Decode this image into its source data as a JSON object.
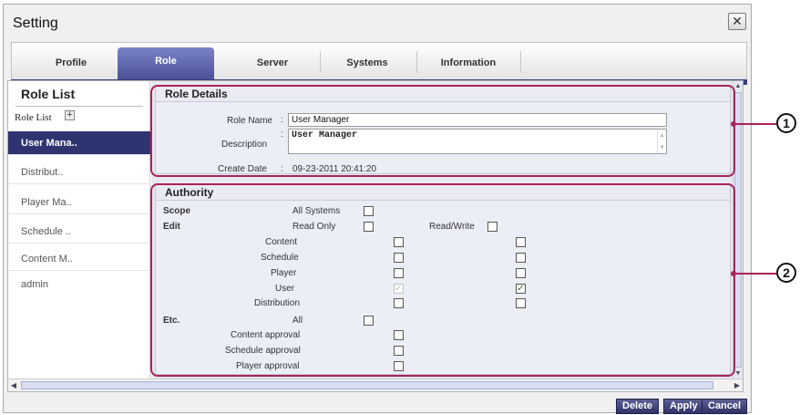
{
  "window": {
    "title": "Setting",
    "close_glyph": "✕"
  },
  "tabs": [
    {
      "label": "Profile"
    },
    {
      "label": "Role",
      "active": true
    },
    {
      "label": "Server"
    },
    {
      "label": "Systems"
    },
    {
      "label": "Information"
    }
  ],
  "sidebar": {
    "title": "Role List",
    "subtitle": "Role List",
    "add_glyph": "+",
    "items": [
      {
        "label": "User Mana..",
        "selected": true
      },
      {
        "label": "Distribut.."
      },
      {
        "label": "Player Ma.."
      },
      {
        "label": "Schedule .."
      },
      {
        "label": "Content M.."
      },
      {
        "label": "admin"
      }
    ]
  },
  "role_details": {
    "heading": "Role Details",
    "name_label": "Role Name",
    "name_value": "User Manager",
    "desc_label": "Description",
    "desc_value": "User Manager",
    "date_label": "Create Date",
    "date_value": "09-23-2011 20:41:20",
    "colon": ":"
  },
  "authority": {
    "heading": "Authority",
    "scope_label": "Scope",
    "all_systems_label": "All Systems",
    "all_systems_checked": false,
    "edit_label": "Edit",
    "read_only_label": "Read Only",
    "read_write_label": "Read/Write",
    "read_only_checked": false,
    "read_write_checked": false,
    "edit_items": [
      {
        "label": "Content",
        "ro": false,
        "rw": false,
        "ro_disabled": false
      },
      {
        "label": "Schedule",
        "ro": false,
        "rw": false,
        "ro_disabled": false
      },
      {
        "label": "Player",
        "ro": false,
        "rw": false,
        "ro_disabled": false
      },
      {
        "label": "User",
        "ro": true,
        "rw": true,
        "ro_disabled": true
      },
      {
        "label": "Distribution",
        "ro": false,
        "rw": false,
        "ro_disabled": false
      }
    ],
    "etc_label": "Etc.",
    "all_label": "All",
    "all_checked": false,
    "etc_items": [
      {
        "label": "Content approval",
        "checked": false
      },
      {
        "label": "Schedule approval",
        "checked": false
      },
      {
        "label": "Player approval",
        "checked": false
      }
    ]
  },
  "callouts": [
    "1",
    "2"
  ],
  "buttons": {
    "delete": "Delete",
    "apply": "Apply",
    "cancel": "Cancel"
  },
  "colors": {
    "accent": "#2e3470",
    "highlight": "#a8245a",
    "check": "#2a7a2a"
  }
}
